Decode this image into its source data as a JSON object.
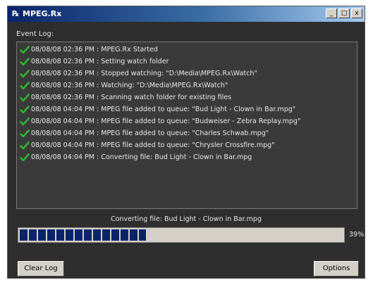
{
  "window": {
    "title": "MPEG.Rx",
    "app_icon": "mpeg-rx-app-icon",
    "caption_buttons": {
      "minimize": "_",
      "maximize": "□",
      "close": "x"
    }
  },
  "event_log": {
    "label": "Event Log:",
    "entries": [
      "08/08/08 02:36 PM : MPEG.Rx Started",
      "08/08/08 02:36 PM : Setting watch folder",
      "08/08/08 02:36 PM : Stopped watching: \"D:\\Media\\MPEG.Rx\\Watch\"",
      "08/08/08 02:36 PM : Watching: \"D:\\Media\\MPEG.Rx\\Watch\"",
      "08/08/08 02:36 PM : Scanning watch folder for existing files",
      "08/08/08 04:04 PM : MPEG file added to queue: \"Bud Light - Clown in Bar.mpg\"",
      "08/08/08 04:04 PM : MPEG file added to queue: \"Budweiser - Zebra Replay.mpg\"",
      "08/08/08 04:04 PM : MPEG file added to queue: \"Charles Schwab.mpg\"",
      "08/08/08 04:04 PM : MPEG file added to queue: \"Chrysler Crossfire.mpg\"",
      "08/08/08 04:04 PM : Converting file: Bud Light - Clown in Bar.mpg"
    ],
    "entry_icon": "check-icon",
    "entry_icon_color": "#2fb52f"
  },
  "status": {
    "text": "Converting file: Bud Light - Clown in Bar.mpg",
    "progress_label": "39%",
    "progress_fraction": 0.39,
    "progress_color": "#0a246a"
  },
  "buttons": {
    "clear_log": "Clear Log",
    "options": "Options"
  }
}
